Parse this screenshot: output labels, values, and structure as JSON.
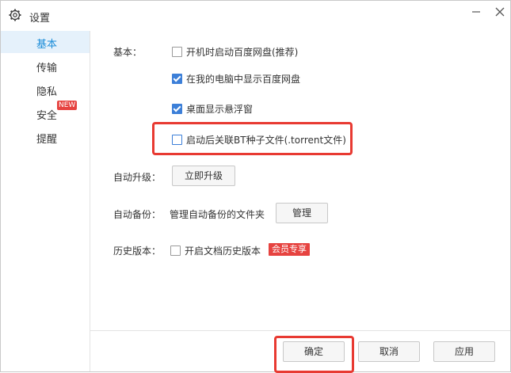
{
  "window": {
    "title": "设置",
    "icons": {
      "title": "gear-icon",
      "minimize": "minimize-icon",
      "close": "close-icon"
    }
  },
  "sidebar": {
    "items": [
      {
        "label": "基本",
        "active": true
      },
      {
        "label": "传输",
        "active": false
      },
      {
        "label": "隐私",
        "active": false
      },
      {
        "label": "安全",
        "active": false,
        "badge": "NEW"
      },
      {
        "label": "提醒",
        "active": false
      }
    ]
  },
  "basic": {
    "label": "基本：",
    "options": [
      {
        "label": "开机时启动百度网盘(推荐)",
        "checked": false
      },
      {
        "label": "在我的电脑中显示百度网盘",
        "checked": true
      },
      {
        "label": "桌面显示悬浮窗",
        "checked": true
      },
      {
        "label": "启动后关联BT种子文件(.torrent文件)",
        "checked": false
      }
    ]
  },
  "auto_upgrade": {
    "label": "自动升级：",
    "button": "立即升级"
  },
  "auto_backup": {
    "label": "自动备份：",
    "text": "管理自动备份的文件夹",
    "button": "管理"
  },
  "history": {
    "label": "历史版本：",
    "option": "开启文档历史版本",
    "checked": false,
    "badge": "会员专享"
  },
  "footer": {
    "ok": "确定",
    "cancel": "取消",
    "apply": "应用"
  },
  "colors": {
    "accent": "#1a8cd8",
    "highlight": "#e83a32",
    "badge": "#e64340",
    "active_bg": "#e5f1fb"
  }
}
